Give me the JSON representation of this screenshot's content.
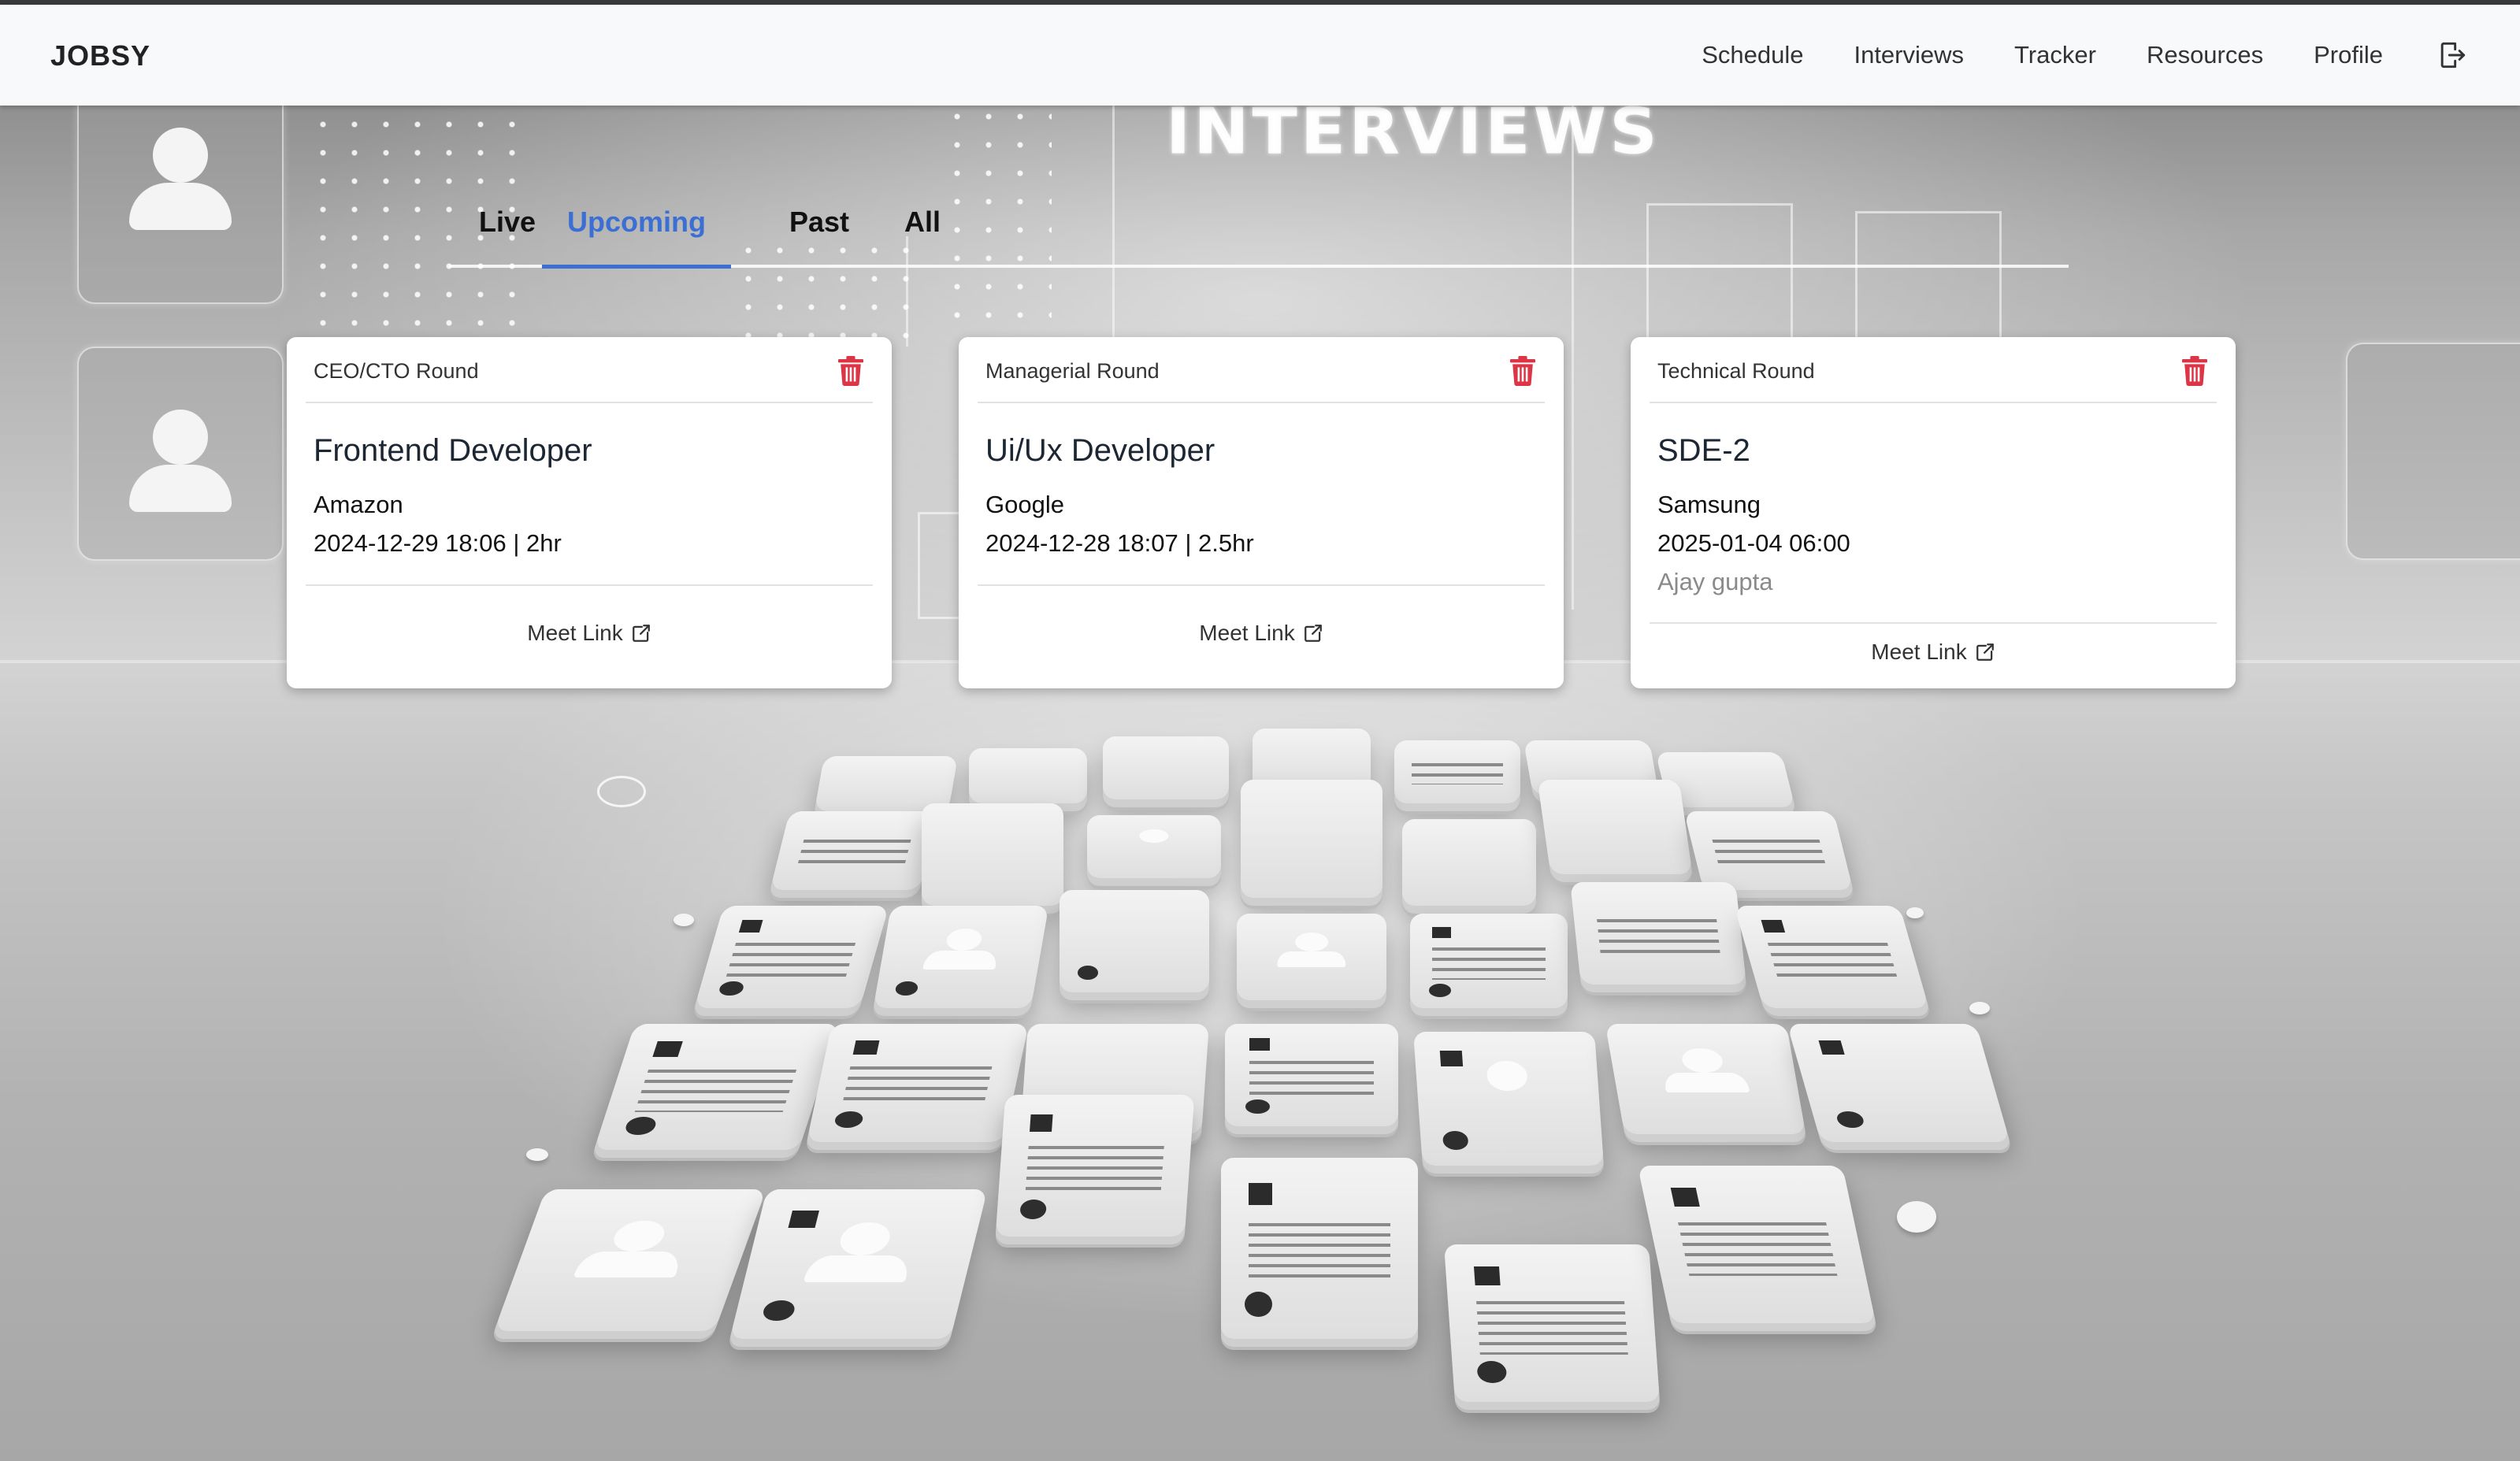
{
  "app": {
    "brand": "JOBSY"
  },
  "nav": {
    "items": [
      {
        "label": "Schedule"
      },
      {
        "label": "Interviews"
      },
      {
        "label": "Tracker"
      },
      {
        "label": "Resources"
      },
      {
        "label": "Profile"
      }
    ],
    "logout_icon": "logout-icon"
  },
  "background": {
    "title": "INTERVIEWS"
  },
  "tabs": {
    "items": [
      {
        "label": "Live"
      },
      {
        "label": "Upcoming"
      },
      {
        "label": "Past"
      },
      {
        "label": "All"
      }
    ],
    "active": "Upcoming",
    "active_color": "#3b6fd4"
  },
  "cards": [
    {
      "round": "CEO/CTO Round",
      "title": "Frontend Developer",
      "company": "Amazon",
      "when": "2024-12-29 18:06 | 2hr",
      "interviewer": "",
      "link_label": "Meet Link"
    },
    {
      "round": "Managerial Round",
      "title": "Ui/Ux Developer",
      "company": "Google",
      "when": "2024-12-28 18:07 | 2.5hr",
      "interviewer": "",
      "link_label": "Meet Link"
    },
    {
      "round": "Technical Round",
      "title": "SDE-2",
      "company": "Samsung",
      "when": "2025-01-04 06:00",
      "interviewer": "Ajay gupta",
      "link_label": "Meet Link"
    }
  ],
  "icons": {
    "delete": "trash-icon",
    "external": "external-link-icon"
  },
  "colors": {
    "delete_icon": "#dc3545",
    "navbar_bg": "#f8f9fa"
  }
}
